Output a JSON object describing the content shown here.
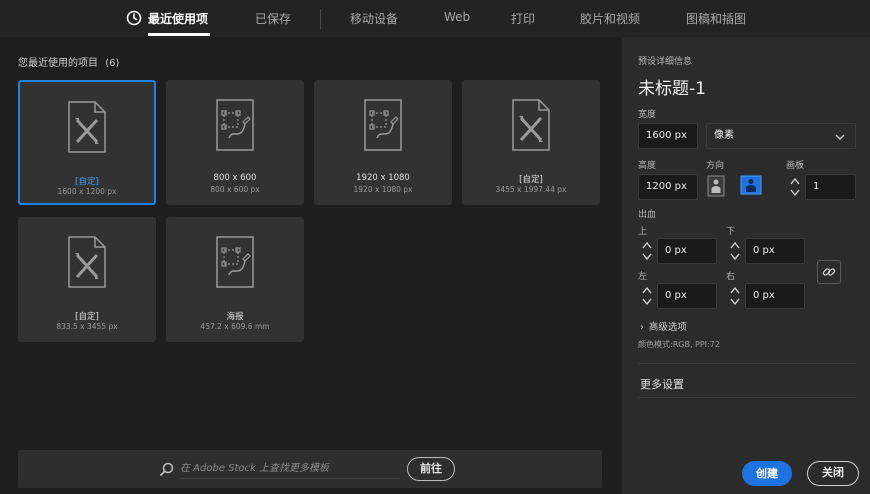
{
  "tabs": [
    {
      "label": "最近使用项",
      "active": true
    },
    {
      "label": "已保存",
      "active": false
    },
    {
      "label": "移动设备",
      "active": false
    },
    {
      "label": "Web",
      "active": false
    },
    {
      "label": "打印",
      "active": false
    },
    {
      "label": "胶片和视频",
      "active": false
    },
    {
      "label": "图稿和插图",
      "active": false
    }
  ],
  "recent": {
    "title": "您最近使用的项目",
    "count": "(6)",
    "items": [
      {
        "name": "[自定]",
        "dims": "1600 x 1200 px",
        "icon": "custom-document-icon",
        "selected": true
      },
      {
        "name": "800 x 600",
        "dims": "800 x 600 px",
        "icon": "template-document-icon",
        "selected": false
      },
      {
        "name": "1920 x 1080",
        "dims": "1920 x 1080 px",
        "icon": "template-document-icon",
        "selected": false
      },
      {
        "name": "[自定]",
        "dims": "3455 x 1997.44 px",
        "icon": "custom-document-icon",
        "selected": false
      },
      {
        "name": "[自定]",
        "dims": "833.5 x 3455 px",
        "icon": "custom-document-icon",
        "selected": false
      },
      {
        "name": "海报",
        "dims": "457.2 x 609.6 mm",
        "icon": "template-document-icon",
        "selected": false
      }
    ]
  },
  "search": {
    "placeholder": "在 Adobe Stock 上查找更多模板",
    "go_label": "前往"
  },
  "details": {
    "header": "预设详细信息",
    "title": "未标题-1",
    "width_label": "宽度",
    "width_value": "1600 px",
    "unit_value": "像素",
    "height_label": "高度",
    "height_value": "1200 px",
    "orientation_label": "方向",
    "artboards_label": "画板",
    "artboards_value": "1",
    "bleed_label": "出血",
    "top_label": "上",
    "top_value": "0 px",
    "bottom_label": "下",
    "bottom_value": "0 px",
    "left_label": "左",
    "left_value": "0 px",
    "right_label": "右",
    "right_value": "0 px",
    "advanced_label": "高级选项",
    "color_mode": "颜色模式:RGB, PPI:72",
    "more_settings": "更多设置"
  },
  "footer": {
    "create_label": "创建",
    "close_label": "关闭"
  },
  "colors": {
    "accent": "#1f73e0",
    "selected_border": "#1e84e8"
  }
}
